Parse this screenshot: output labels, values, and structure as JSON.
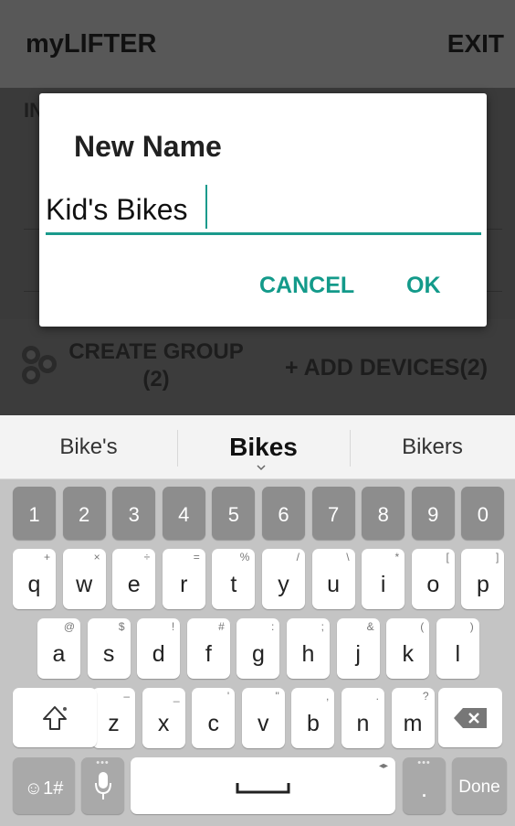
{
  "app": {
    "title": "myLIFTER",
    "exit_label": "EXIT",
    "fragment_letters": "IN",
    "create_group_line1": "CREATE GROUP",
    "create_group_line2": "(2)",
    "add_devices_label": "+ ADD DEVICES(2)"
  },
  "dialog": {
    "title": "New Name",
    "input_value": "Kid's Bikes",
    "cancel_label": "CANCEL",
    "ok_label": "OK",
    "accent_color": "#1a9a8c"
  },
  "suggestions": [
    "Bike's",
    "Bikes",
    "Bikers"
  ],
  "keyboard": {
    "number_row": [
      "1",
      "2",
      "3",
      "4",
      "5",
      "6",
      "7",
      "8",
      "9",
      "0"
    ],
    "row1": [
      {
        "key": "q",
        "hint": "+"
      },
      {
        "key": "w",
        "hint": "×"
      },
      {
        "key": "e",
        "hint": "÷"
      },
      {
        "key": "r",
        "hint": "="
      },
      {
        "key": "t",
        "hint": "%"
      },
      {
        "key": "y",
        "hint": "/"
      },
      {
        "key": "u",
        "hint": "\\"
      },
      {
        "key": "i",
        "hint": "*"
      },
      {
        "key": "o",
        "hint": "["
      },
      {
        "key": "p",
        "hint": "]"
      }
    ],
    "row2": [
      {
        "key": "a",
        "hint": "@"
      },
      {
        "key": "s",
        "hint": "$"
      },
      {
        "key": "d",
        "hint": "!"
      },
      {
        "key": "f",
        "hint": "#"
      },
      {
        "key": "g",
        "hint": ":"
      },
      {
        "key": "h",
        "hint": ";"
      },
      {
        "key": "j",
        "hint": "&"
      },
      {
        "key": "k",
        "hint": "("
      },
      {
        "key": "l",
        "hint": ")"
      }
    ],
    "row3": [
      {
        "key": "z",
        "hint": "–"
      },
      {
        "key": "x",
        "hint": "_"
      },
      {
        "key": "c",
        "hint": "'"
      },
      {
        "key": "v",
        "hint": "\""
      },
      {
        "key": "b",
        "hint": ","
      },
      {
        "key": "n",
        "hint": "."
      },
      {
        "key": "m",
        "hint": "?"
      }
    ],
    "symbols_label": "☺1#",
    "done_label": "Done",
    "period_label": "."
  }
}
